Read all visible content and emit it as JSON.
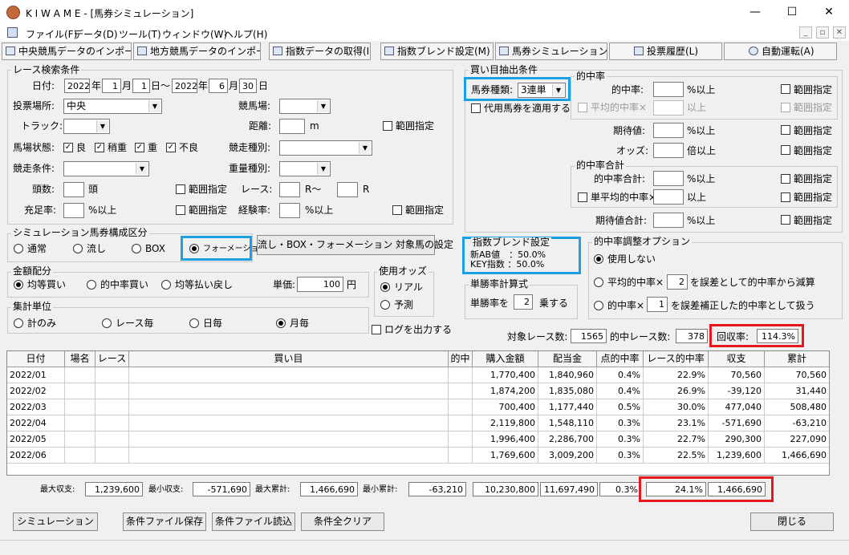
{
  "window": {
    "title": "K I W A M E - [馬券シミュレーション]",
    "minimize": "—",
    "maximize": "☐",
    "close": "✕"
  },
  "menu": [
    "ファイル(F)",
    "データ(D)",
    "ツール(T)",
    "ウィンドウ(W)",
    "ヘルプ(H)"
  ],
  "mdi_buttons": [
    "_",
    "▫",
    "✕"
  ],
  "tabs": [
    "中央競馬データのインポート(J)",
    "地方競馬データのインポート(N)",
    "指数データの取得(I)",
    "指数ブレンド設定(M)",
    "馬券シミュレーション(B)",
    "投票履歴(L)",
    "自動運転(A)"
  ],
  "race_search": {
    "title": "レース検索条件",
    "date_label": "日付:",
    "date_from": {
      "year": "2022",
      "month": "1",
      "day": "1"
    },
    "date_to": {
      "year": "2022",
      "month": "6",
      "day": "30"
    },
    "u_year": "年",
    "u_month": "月",
    "u_day": "日",
    "tilde": "日〜",
    "u_day2": "日",
    "venue_label": "投票場所:",
    "venue_value": "中央",
    "course_label": "競馬場:",
    "course_value": "",
    "track_label": "トラック:",
    "track_value": "",
    "distance_label": "距離:",
    "distance_value": "",
    "distance_unit": "m",
    "range_label": "範囲指定",
    "condition_label": "馬場状態:",
    "conditions": [
      "良",
      "稍重",
      "重",
      "不良"
    ],
    "race_type_label": "競走種別:",
    "race_cond_label": "競走条件:",
    "weight_type_label": "重量種別:",
    "heads_label": "頭数:",
    "heads_unit": "頭",
    "race_label": "レース:",
    "race_unit1": "R〜",
    "race_unit2": "R",
    "fill_label": "充足率:",
    "fill_unit": "%以上",
    "exp_label": "経験率:",
    "exp_unit": "%以上"
  },
  "sim_group": {
    "title": "シミュレーション馬券構成区分",
    "options": [
      "通常",
      "流し",
      "BOX",
      "フォーメーション"
    ],
    "selected": "フォーメーション",
    "setting_button": "流し・BOX・フォーメーション 対象馬の設定"
  },
  "amount": {
    "title": "金額配分",
    "options": [
      "均等買い",
      "的中率買い",
      "均等払い戻し"
    ],
    "selected": "均等買い",
    "unit_label": "単価:",
    "unit_value": "100",
    "unit_yen": "円"
  },
  "odds": {
    "title": "使用オッズ",
    "options": [
      "リアル",
      "予測"
    ],
    "selected": "リアル"
  },
  "tally": {
    "title": "集計単位",
    "options": [
      "計のみ",
      "レース毎",
      "日毎",
      "月毎"
    ],
    "selected": "月毎",
    "log_label": "ログを出力する"
  },
  "buy": {
    "title": "買い目抽出条件",
    "ticket_label": "馬券種類:",
    "ticket_value": "3連単",
    "substitute_label": "代用馬券を適用する",
    "hit_title": "的中率",
    "hit_label": "的中率:",
    "hit_unit": "%以上",
    "avg_hit_label": "平均的中率×",
    "avg_hit_unit": "以上",
    "ev_label": "期待値:",
    "ev_unit": "%以上",
    "odds_label": "オッズ:",
    "odds_unit": "倍以上",
    "sum_title": "的中率合計",
    "sum_label": "的中率合計:",
    "sum_unit": "%以上",
    "single_avg_label": "単平均的中率×",
    "single_avg_unit": "以上",
    "ev_sum_label": "期待値合計:",
    "ev_sum_unit": "%以上",
    "range": "範囲指定"
  },
  "blend": {
    "title": "指数ブレンド設定",
    "line1": "新AB値　：50.0%",
    "line2": "KEY指数 ：50.0%"
  },
  "win_calc": {
    "title": "単勝率計算式",
    "prefix": "単勝率を",
    "value": "2",
    "suffix": "乗する"
  },
  "hit_adjust": {
    "title": "的中率調整オプション",
    "opt1": "使用しない",
    "opt2_prefix": "平均的中率×",
    "opt2_value": "2",
    "opt2_suffix": "を誤差として的中率から減算",
    "opt3_prefix": "的中率×",
    "opt3_value": "1",
    "opt3_suffix": "を誤差補正した的中率として扱う",
    "selected": "使用しない"
  },
  "summary": {
    "target_label": "対象レース数:",
    "target_value": "1565",
    "hit_label": "的中レース数:",
    "hit_value": "378",
    "recovery_label": "回収率:",
    "recovery_value": "114.3%"
  },
  "grid": {
    "columns": [
      "日付",
      "場名",
      "レース",
      "買い目",
      "的中",
      "購入金額",
      "配当金",
      "点的中率",
      "レース的中率",
      "収支",
      "累計"
    ],
    "rows": [
      [
        "2022/01",
        "",
        "",
        "",
        "",
        "1,770,400",
        "1,840,960",
        "0.4%",
        "22.9%",
        "70,560",
        "70,560"
      ],
      [
        "2022/02",
        "",
        "",
        "",
        "",
        "1,874,200",
        "1,835,080",
        "0.4%",
        "26.9%",
        "-39,120",
        "31,440"
      ],
      [
        "2022/03",
        "",
        "",
        "",
        "",
        "700,400",
        "1,177,440",
        "0.5%",
        "30.0%",
        "477,040",
        "508,480"
      ],
      [
        "2022/04",
        "",
        "",
        "",
        "",
        "2,119,800",
        "1,548,110",
        "0.3%",
        "23.1%",
        "-571,690",
        "-63,210"
      ],
      [
        "2022/05",
        "",
        "",
        "",
        "",
        "1,996,400",
        "2,286,700",
        "0.3%",
        "22.7%",
        "290,300",
        "227,090"
      ],
      [
        "2022/06",
        "",
        "",
        "",
        "",
        "1,769,600",
        "3,009,200",
        "0.3%",
        "22.5%",
        "1,239,600",
        "1,466,690"
      ]
    ]
  },
  "totals": {
    "max_income_label": "最大収支:",
    "max_income": "1,239,600",
    "min_income_label": "最小収支:",
    "min_income": "-571,690",
    "max_cum_label": "最大累計:",
    "max_cum": "1,466,690",
    "min_cum_label": "最小累計:",
    "min_cum": "-63,210",
    "purchase": "10,230,800",
    "payout": "11,697,490",
    "point_rate": "0.3%",
    "race_rate": "24.1%",
    "cumulative": "1,466,690"
  },
  "buttons": {
    "simulate": "シミュレーション",
    "save": "条件ファイル保存",
    "load": "条件ファイル読込",
    "clear": "条件全クリア",
    "close": "閉じる"
  },
  "colors": {
    "highlight_blue": "#1ba1e2",
    "highlight_red": "#e8171e"
  }
}
